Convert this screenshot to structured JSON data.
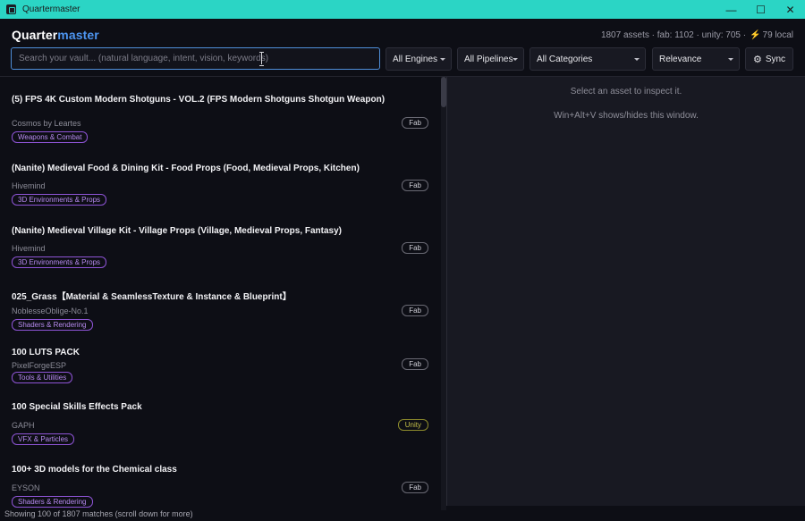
{
  "window": {
    "title": "Quartermaster",
    "controls": {
      "minimize": "—",
      "maximize": "☐",
      "close": "✕"
    }
  },
  "header": {
    "logo_part1": "Quarter",
    "logo_part2": "master",
    "stats": "1807 assets · fab: 1102 · unity: 705 ·",
    "local_icon": "bolt-icon",
    "local_label": "79 local"
  },
  "search": {
    "placeholder": "Search your vault... (natural language, intent, vision, keywords)",
    "value": ""
  },
  "filters": {
    "engine": "All Engines",
    "pipeline": "All Pipelines",
    "category": "All Categories",
    "sort": "Relevance",
    "sync_label": "Sync"
  },
  "results": [
    {
      "title": "(5) FPS 4K Custom Modern Shotguns - VOL.2 (FPS Modern Shotguns Shotgun Weapon)",
      "author": "Cosmos by Leartes",
      "category": "Weapons & Combat",
      "source": "Fab"
    },
    {
      "title": "(Nanite) Medieval Food & Dining Kit - Food Props (Food, Medieval Props, Kitchen)",
      "author": "Hivemind",
      "category": "3D Environments & Props",
      "source": "Fab"
    },
    {
      "title": "(Nanite) Medieval Village Kit - Village Props (Village, Medieval Props, Fantasy)",
      "author": "Hivemind",
      "category": "3D Environments & Props",
      "source": "Fab"
    },
    {
      "title": "025_Grass【Material & SeamlessTexture & Instance & Blueprint】",
      "author": "NoblesseOblige-No.1",
      "category": "Shaders & Rendering",
      "source": "Fab"
    },
    {
      "title": "100 LUTS PACK",
      "author": "PixelForgeESP",
      "category": "Tools & Utilities",
      "source": "Fab"
    },
    {
      "title": "100 Special Skills Effects Pack",
      "author": "GAPH",
      "category": "VFX & Particles",
      "source": "Unity"
    },
    {
      "title": "100+ 3D models for the Chemical class",
      "author": "EYSON",
      "category": "Shaders & Rendering",
      "source": "Fab"
    }
  ],
  "inspector": {
    "hint": "Select an asset to inspect it.",
    "shortcut_hint": "Win+Alt+V shows/hides this window."
  },
  "status": "Showing 100 of 1807 matches (scroll down for more)",
  "colors": {
    "titlebar": "#2bd5c5",
    "accent_blue": "#4d95f0",
    "tag_purple": "#8e54d6",
    "unity_badge": "#c6c249"
  }
}
